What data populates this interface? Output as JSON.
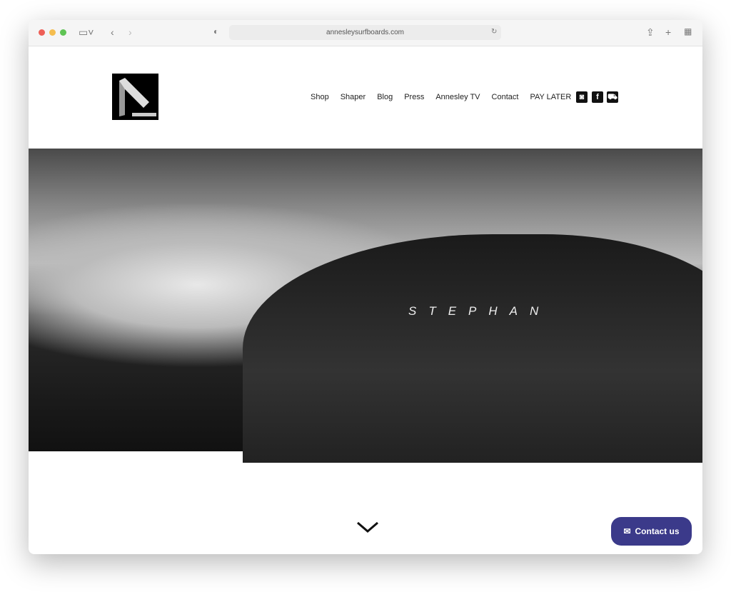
{
  "browser": {
    "url": "annesleysurfboards.com"
  },
  "nav": {
    "items": [
      "Shop",
      "Shaper",
      "Blog",
      "Press",
      "Annesley TV",
      "Contact",
      "PAY LATER"
    ]
  },
  "logo": {
    "text": "annesley"
  },
  "social": [
    "instagram-icon",
    "facebook-icon",
    "cart-icon"
  ],
  "hero": {
    "title": "STEPHAN"
  },
  "contact": {
    "label": "Contact us"
  },
  "colors": {
    "contact_bg": "#3b3a8a"
  }
}
